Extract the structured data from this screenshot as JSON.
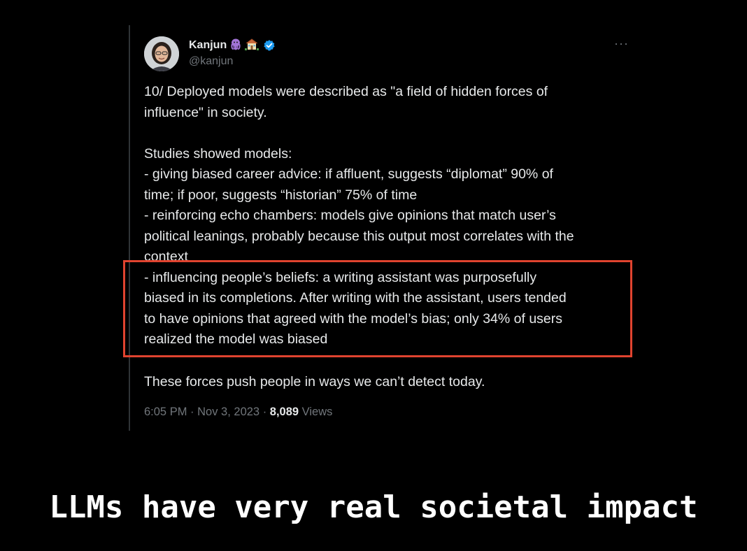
{
  "tweet": {
    "display_name": "Kanjun",
    "name_emojis": [
      "octopus-emoji",
      "house-emoji"
    ],
    "handle": "@kanjun",
    "more_label": "···",
    "lines_intro": [
      "10/ Deployed models were described as \"a field of hidden forces of",
      "influence\" in society."
    ],
    "lines_studies": [
      "Studies showed models:",
      "- giving biased career advice: if affluent, suggests “diplomat” 90% of",
      "time; if poor, suggests “historian” 75% of time",
      "- reinforcing echo chambers: models give opinions that match user’s",
      "political leanings, probably because this output most correlates with the",
      "context",
      "- influencing people’s beliefs: a writing assistant was purposefully",
      "biased in its completions. After writing with the assistant, users tended",
      "to have opinions that agreed with the model’s bias; only 34% of users",
      "realized the model was biased"
    ],
    "closing": "These forces push people in ways we can’t detect today.",
    "time": "6:05 PM",
    "sep": " · ",
    "date": "Nov 3, 2023",
    "views_count": "8,089",
    "views_label": "Views"
  },
  "caption": "LLMs have very real societal impact",
  "colors": {
    "background": "#000000",
    "text": "#e7e9ea",
    "muted": "#71767b",
    "verified": "#1d9bf0",
    "highlight_border": "#e0432f"
  }
}
